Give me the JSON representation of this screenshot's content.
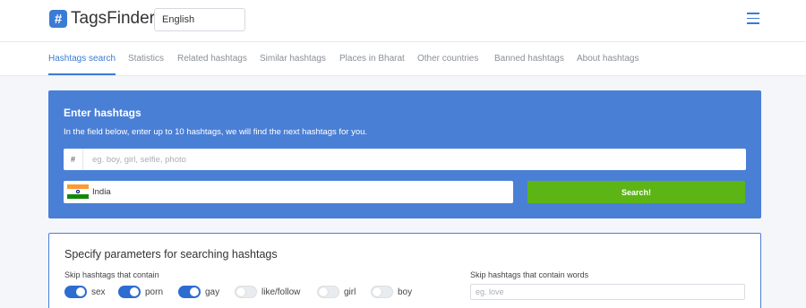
{
  "header": {
    "logo_symbol": "#",
    "logo_text": "TagsFinder",
    "language": "English",
    "accent_color": "#3a7bd5"
  },
  "nav": {
    "items": [
      {
        "label": "Hashtags search",
        "active": true
      },
      {
        "label": "Statistics"
      },
      {
        "label": "Related hashtags"
      },
      {
        "label": "Similar hashtags"
      },
      {
        "label": "Places in Bharat"
      },
      {
        "label": "Other countries"
      },
      {
        "label": "Banned hashtags"
      },
      {
        "label": "About hashtags"
      }
    ]
  },
  "search_panel": {
    "title": "Enter hashtags",
    "description": "In the field below, enter up to 10 hashtags, we will find the next hashtags for you.",
    "hash_prefix": "#",
    "input_placeholder": "eg. boy, girl, selfie, photo",
    "country": "India",
    "search_label": "Search!",
    "panel_color": "#4a7fd6",
    "button_color": "#5cb514"
  },
  "params": {
    "title": "Specify parameters for searching hashtags",
    "skip_label": "Skip hashtags that contain",
    "skip_words_label": "Skip hashtags that contain words",
    "words_placeholder": "eg. love",
    "toggles": [
      {
        "label": "sex",
        "on": true
      },
      {
        "label": "porn",
        "on": true
      },
      {
        "label": "gay",
        "on": true
      },
      {
        "label": "like/follow",
        "on": false
      },
      {
        "label": "girl",
        "on": false
      },
      {
        "label": "boy",
        "on": false
      }
    ]
  }
}
